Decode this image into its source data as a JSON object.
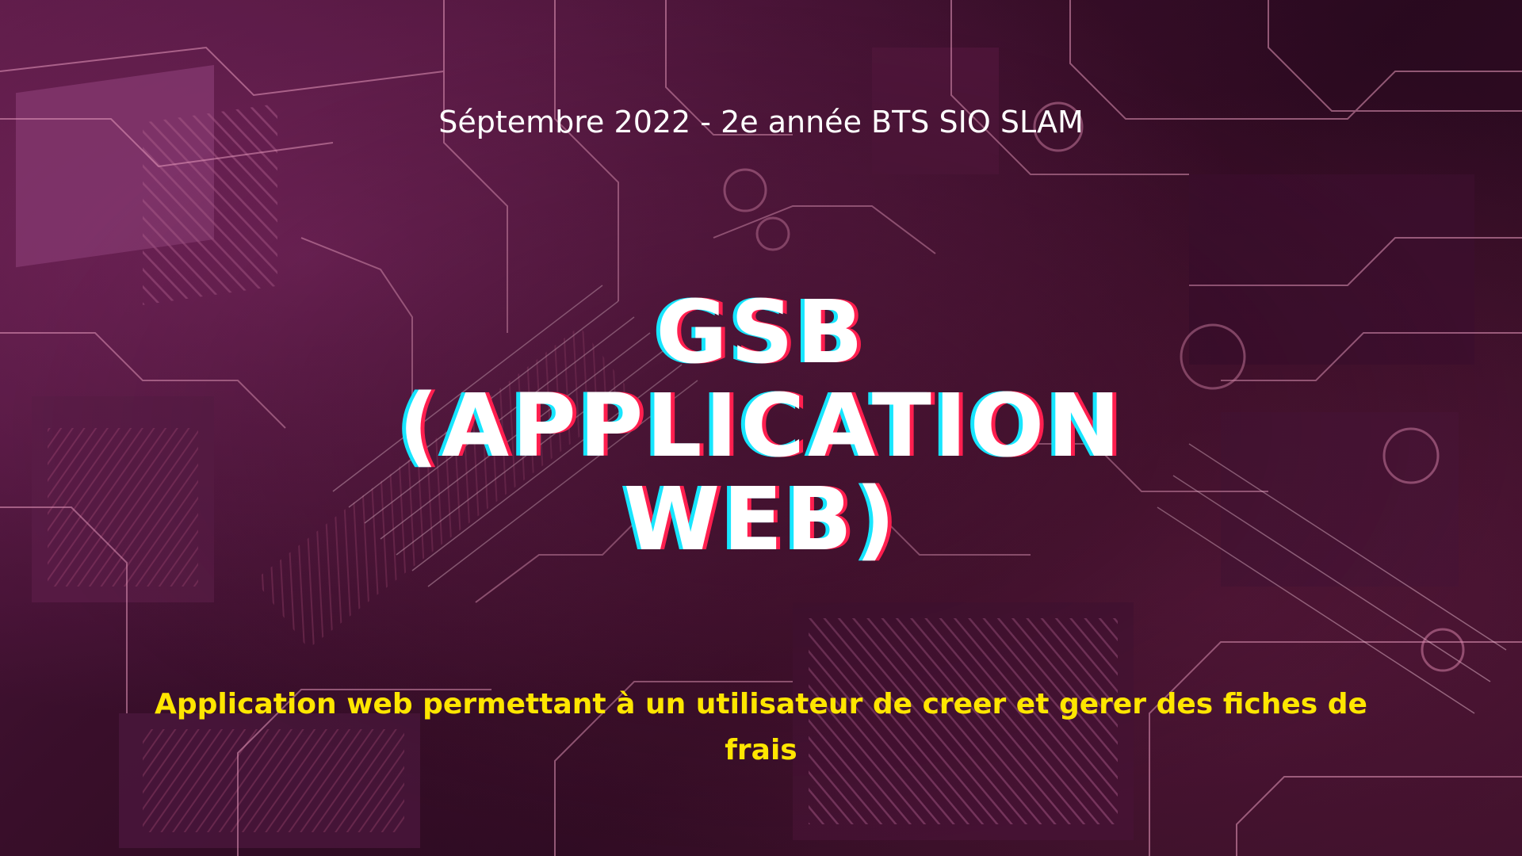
{
  "slide": {
    "subtitle": "Séptembre 2022 - 2e année BTS SIO SLAM",
    "title_lines": [
      "GSB",
      "(APPLICATION",
      "WEB)"
    ],
    "description": "Application web permettant à un utilisateur de creer et gerer des fiches de frais",
    "colors": {
      "title": "#ffffff",
      "title_shadow_left": "#17e6ff",
      "title_shadow_right": "#ff1f4f",
      "description": "#ffe600",
      "subtitle": "#ffffff",
      "background": "#3b0f2c",
      "trace": "#f2a6c8"
    }
  }
}
